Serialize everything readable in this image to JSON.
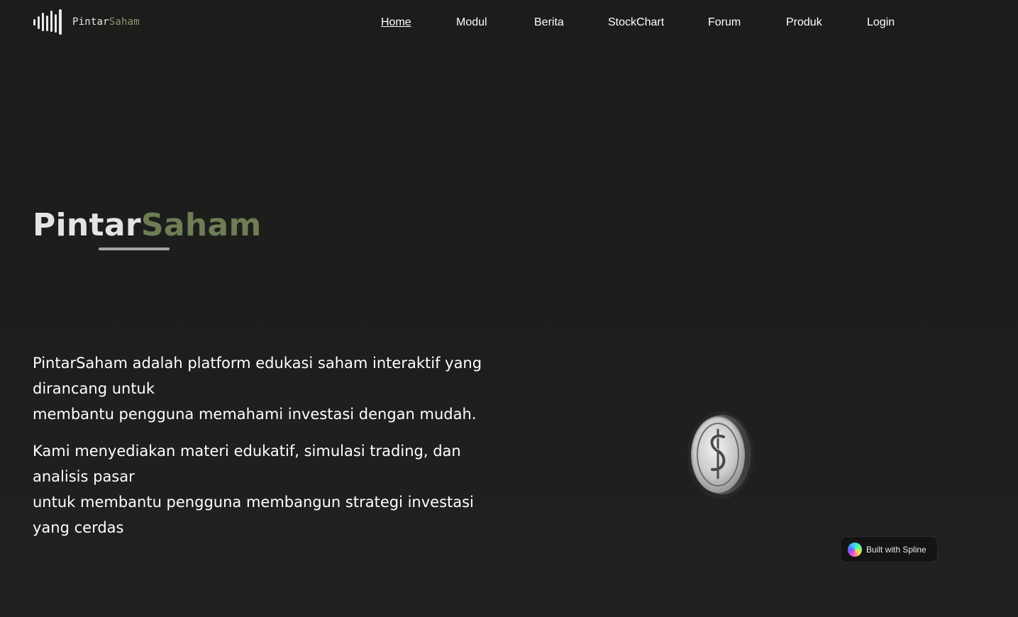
{
  "brand": {
    "name_part1": "Pintar",
    "name_part2": "Saham",
    "logo_icon": "bars-waveform-icon",
    "accent_color": "#8a9a6c"
  },
  "nav": {
    "items": [
      {
        "label": "Home",
        "active": true
      },
      {
        "label": "Modul",
        "active": false
      },
      {
        "label": "Berita",
        "active": false
      },
      {
        "label": "StockChart",
        "active": false
      },
      {
        "label": "Forum",
        "active": false
      },
      {
        "label": "Produk",
        "active": false
      },
      {
        "label": "Login",
        "active": false
      }
    ]
  },
  "hero": {
    "title_part1": "Pintar",
    "title_part2": "Saham",
    "paragraph1": [
      "PintarSaham adalah platform edukasi saham interaktif yang",
      "dirancang untuk",
      "membantu pengguna memahami investasi dengan mudah."
    ],
    "paragraph2": [
      "Kami menyediakan materi edukatif, simulasi trading, dan",
      "analisis pasar",
      "untuk membantu pengguna membangun strategi investasi",
      "yang cerdas"
    ],
    "coin_icon": "dollar-coin-icon"
  },
  "badge": {
    "label": "Built with Spline",
    "icon": "spline-logo-icon"
  },
  "colors": {
    "background": "#1d1e1c",
    "text": "#ffffff",
    "title_light": "#e4e4e4",
    "title_accent": "#6e7d55"
  }
}
